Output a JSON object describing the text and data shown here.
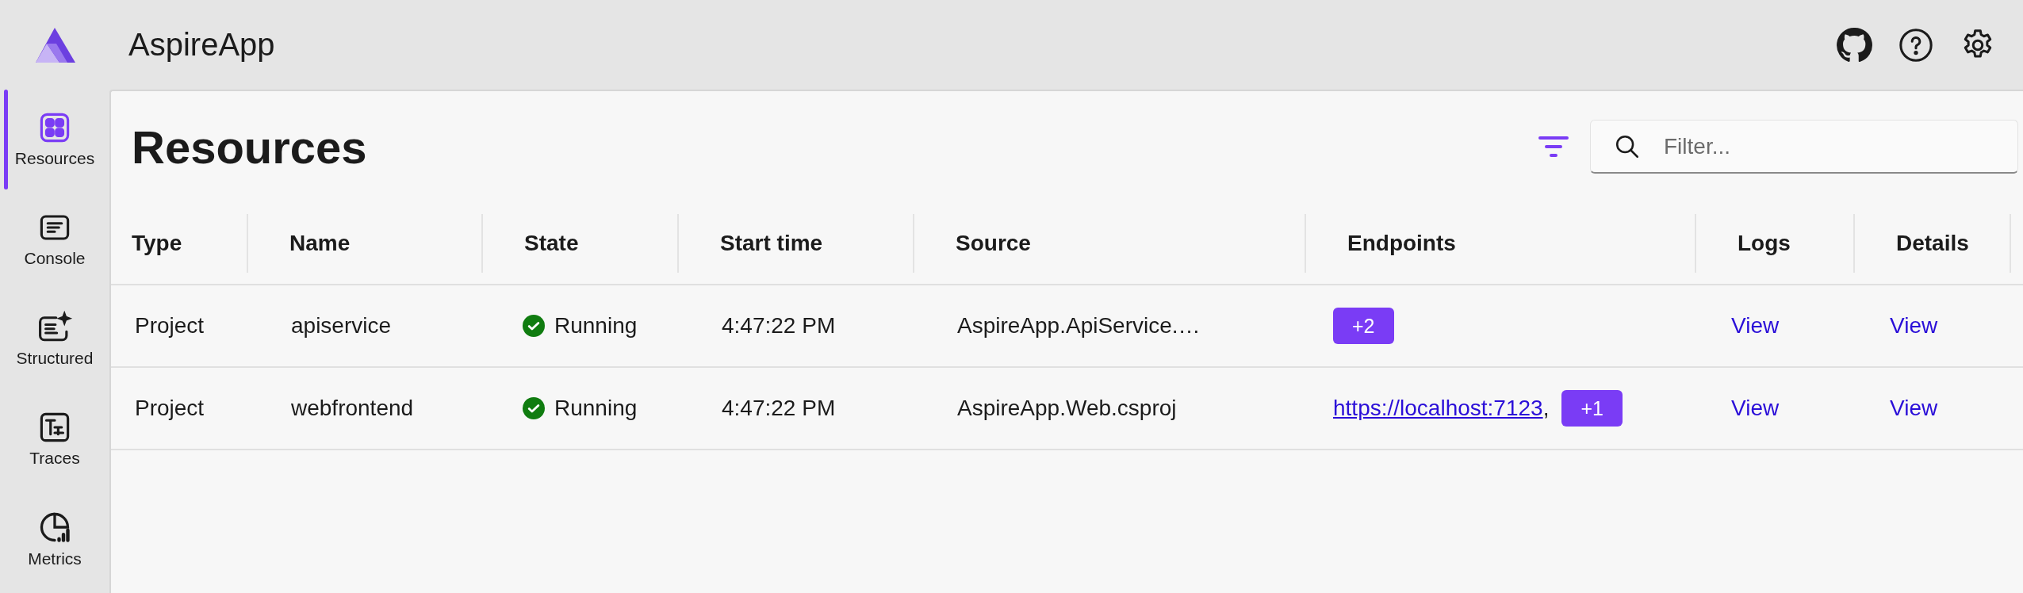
{
  "header": {
    "title": "AspireApp"
  },
  "nav": [
    {
      "label": "Resources",
      "selected": true
    },
    {
      "label": "Console",
      "selected": false
    },
    {
      "label": "Structured",
      "selected": false
    },
    {
      "label": "Traces",
      "selected": false
    },
    {
      "label": "Metrics",
      "selected": false
    }
  ],
  "page": {
    "title": "Resources"
  },
  "filter": {
    "placeholder": "Filter..."
  },
  "table": {
    "columns": [
      "Type",
      "Name",
      "State",
      "Start time",
      "Source",
      "Endpoints",
      "Logs",
      "Details"
    ],
    "rows": [
      {
        "type": "Project",
        "name": "apiservice",
        "state": "Running",
        "start_time": "4:47:22 PM",
        "source": "AspireApp.ApiService.…",
        "endpoints": {
          "more": "+2"
        },
        "logs": "View",
        "details": "View"
      },
      {
        "type": "Project",
        "name": "webfrontend",
        "state": "Running",
        "start_time": "4:47:22 PM",
        "source": "AspireApp.Web.csproj",
        "endpoints": {
          "link": "https://localhost:7123",
          "separator": ",",
          "more": "+1"
        },
        "logs": "View",
        "details": "View"
      }
    ]
  }
}
